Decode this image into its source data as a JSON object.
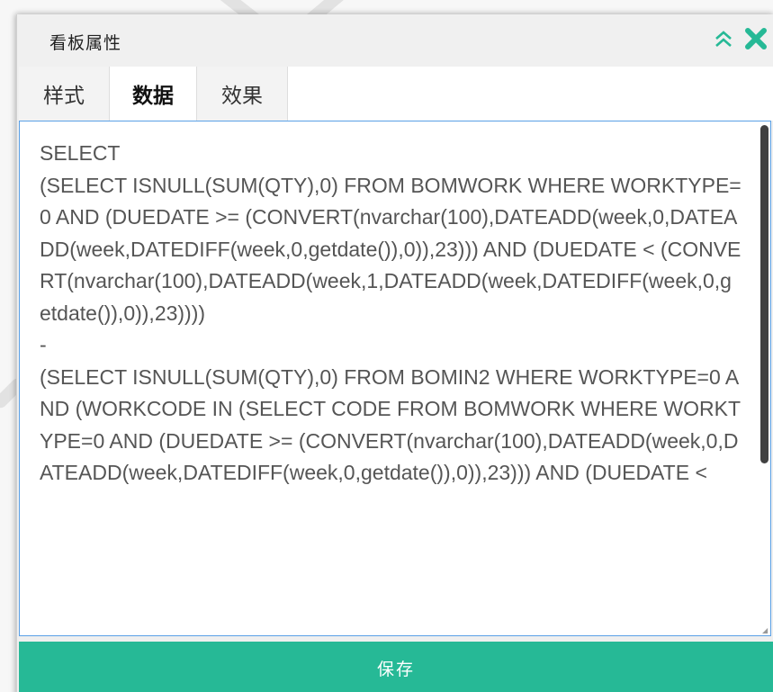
{
  "dialog": {
    "title": "看板属性"
  },
  "tabs": [
    {
      "label": "样式",
      "active": false
    },
    {
      "label": "数据",
      "active": true
    },
    {
      "label": "效果",
      "active": false
    }
  ],
  "editor": {
    "sql": "SELECT\n(SELECT ISNULL(SUM(QTY),0) FROM BOMWORK WHERE WORKTYPE=0 AND (DUEDATE >= (CONVERT(nvarchar(100),DATEADD(week,0,DATEADD(week,DATEDIFF(week,0,getdate()),0)),23))) AND (DUEDATE < (CONVERT(nvarchar(100),DATEADD(week,1,DATEADD(week,DATEDIFF(week,0,getdate()),0)),23))))\n-\n(SELECT ISNULL(SUM(QTY),0) FROM BOMIN2 WHERE WORKTYPE=0 AND (WORKCODE IN (SELECT CODE FROM BOMWORK WHERE WORKTYPE=0 AND (DUEDATE >= (CONVERT(nvarchar(100),DATEADD(week,0,DATEADD(week,DATEDIFF(week,0,getdate()),0)),23))) AND (DUEDATE <"
  },
  "footer": {
    "save_label": "保存"
  },
  "colors": {
    "accent": "#26b996",
    "icons": "#26b996",
    "editor_border": "#5aa0e6"
  },
  "icons": {
    "collapse": "double-chevron-up-icon",
    "close": "close-x-icon"
  }
}
